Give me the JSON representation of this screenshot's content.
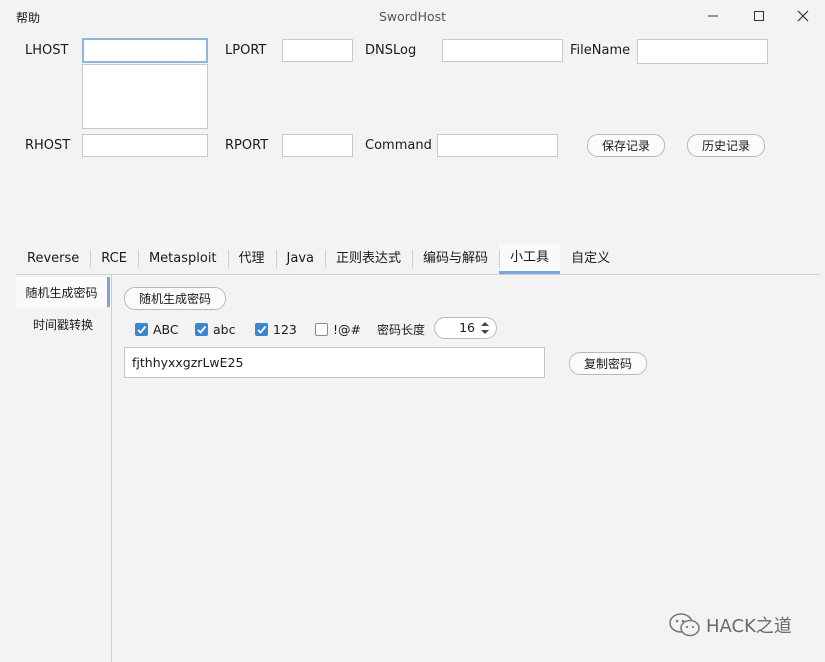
{
  "window": {
    "title": "SwordHost",
    "menu": "帮助"
  },
  "form": {
    "lhost_label": "LHOST",
    "lhost_value": "",
    "lport_label": "LPORT",
    "lport_value": "",
    "dnslog_label": "DNSLog",
    "dnslog_value": "",
    "filename_label": "FileName",
    "filename_value": "",
    "rhost_label": "RHOST",
    "rhost_value": "",
    "rport_label": "RPORT",
    "rport_value": "",
    "command_label": "Command",
    "command_value": "",
    "save_label": "保存记录",
    "history_label": "历史记录"
  },
  "tabs": [
    {
      "label": "Reverse"
    },
    {
      "label": "RCE"
    },
    {
      "label": "Metasploit"
    },
    {
      "label": "代理"
    },
    {
      "label": "Java"
    },
    {
      "label": "正则表达式"
    },
    {
      "label": "编码与解码"
    },
    {
      "label": "小工具",
      "active": true
    },
    {
      "label": "自定义"
    }
  ],
  "sidebar": {
    "items": [
      {
        "label": "随机生成密码",
        "active": true
      },
      {
        "label": "时间戳转换"
      }
    ]
  },
  "tool": {
    "generate_label": "随机生成密码",
    "options": [
      {
        "label": "ABC",
        "checked": true
      },
      {
        "label": "abc",
        "checked": true
      },
      {
        "label": "123",
        "checked": true
      },
      {
        "label": "!@#",
        "checked": false
      }
    ],
    "length_label": "密码长度",
    "length_value": "16",
    "password": "fjthhyxxgzrLwE25",
    "copy_label": "复制密码"
  },
  "watermark": "HACK之道",
  "colors": {
    "accent": "#3a86d2",
    "tab_indicator": "#7aa6d8"
  }
}
